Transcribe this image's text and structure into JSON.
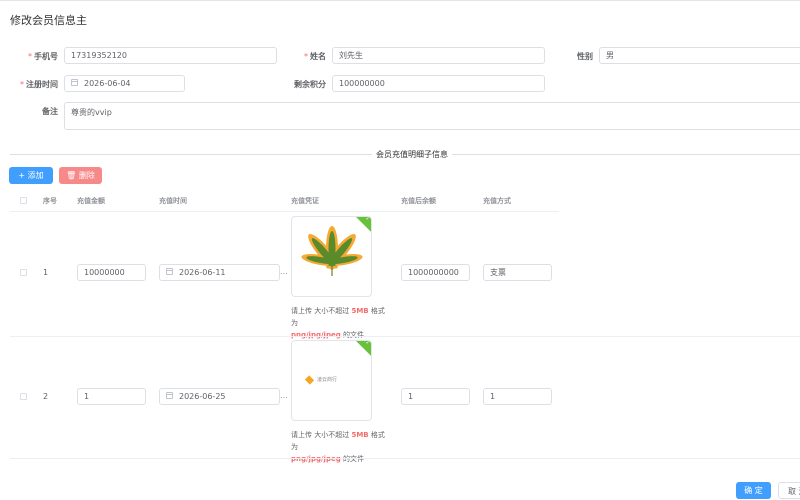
{
  "dialog": {
    "title": "修改会员信息主"
  },
  "form": {
    "phone": {
      "label": "手机号",
      "value": "17319352120",
      "required": true
    },
    "name": {
      "label": "姓名",
      "value": "刘先生",
      "required": true
    },
    "gender": {
      "label": "性别",
      "value": "男"
    },
    "reg_time": {
      "label": "注册时间",
      "value": "2026-06-04",
      "required": true
    },
    "points": {
      "label": "剩余积分",
      "value": "100000000"
    },
    "remark": {
      "label": "备注",
      "value": "尊贵的vvip"
    },
    "required_mark": "*"
  },
  "section": {
    "title": "会员充值明细子信息"
  },
  "toolbar": {
    "add_label": "添加",
    "delete_label": "删除"
  },
  "table": {
    "columns": [
      "序号",
      "充值金额",
      "充值时间",
      "充值凭证",
      "充值后余额",
      "充值方式"
    ],
    "rows": [
      {
        "index": "1",
        "amount": "10000000",
        "time": "2026-06-11",
        "balance": "1000000000",
        "method": "支票",
        "ellipsis": "..."
      },
      {
        "index": "2",
        "amount": "1",
        "time": "2026-06-25",
        "balance": "1",
        "method": "1",
        "ellipsis": "..."
      }
    ],
    "upload_tip": {
      "prefix": "请上传 大小不超过",
      "size": "5MB",
      "mid": "格式为",
      "formats": "png/jpg/jpeg",
      "suffix": "的文件"
    },
    "thumb2_text": "凌云商行"
  },
  "footer": {
    "confirm_label": "确 定",
    "cancel_label": "取 消"
  },
  "colors": {
    "primary": "#409eff",
    "danger": "#f78989",
    "success": "#67c23a",
    "required": "#f56c6c"
  }
}
